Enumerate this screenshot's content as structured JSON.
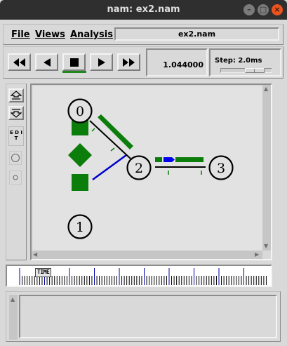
{
  "window": {
    "title": "nam: ex2.nam"
  },
  "menu": {
    "file": "File",
    "views": "Views",
    "analysis": "Analysis"
  },
  "filename": "ex2.nam",
  "controls": {
    "rewind_icon": "fast-rewind-icon",
    "back_icon": "play-backward-icon",
    "stop_icon": "stop-icon",
    "play_icon": "play-forward-icon",
    "ff_icon": "fast-forward-icon",
    "time": "1.044000",
    "step_label": "Step: 2.0ms"
  },
  "tools": {
    "zoom_in_icon": "zoom-in-icon",
    "zoom_out_icon": "zoom-out-icon",
    "edit_label": "E D I T"
  },
  "network": {
    "nodes": [
      {
        "label": "0"
      },
      {
        "label": "1"
      },
      {
        "label": "2"
      },
      {
        "label": "3"
      }
    ],
    "colors": {
      "link_1_2": "#0000cc",
      "packet_green": "#0a7d0a",
      "packet_blue": "#0000ee",
      "link_black": "#000000"
    }
  },
  "timeline": {
    "label": "TIME"
  }
}
